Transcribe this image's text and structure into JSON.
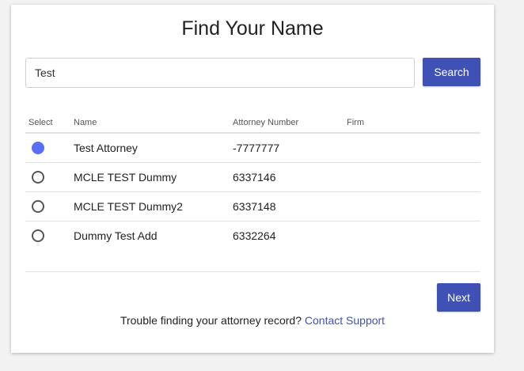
{
  "page": {
    "title": "Find Your Name"
  },
  "search": {
    "value": "Test",
    "button_label": "Search"
  },
  "table": {
    "headers": {
      "select": "Select",
      "name": "Name",
      "attorney_number": "Attorney Number",
      "firm": "Firm"
    },
    "rows": [
      {
        "name": "Test Attorney",
        "attorney_number": "-7777777",
        "firm": "",
        "selected": true
      },
      {
        "name": "MCLE TEST Dummy",
        "attorney_number": "6337146",
        "firm": "",
        "selected": false
      },
      {
        "name": "MCLE TEST Dummy2",
        "attorney_number": "6337148",
        "firm": "",
        "selected": false
      },
      {
        "name": "Dummy Test Add",
        "attorney_number": "6332264",
        "firm": "",
        "selected": false
      }
    ]
  },
  "actions": {
    "next_label": "Next"
  },
  "footer": {
    "text": "Trouble finding your attorney record?",
    "link_label": "Contact Support"
  },
  "colors": {
    "accent": "#3f51b5",
    "radio_selected": "#5c6ef5"
  }
}
